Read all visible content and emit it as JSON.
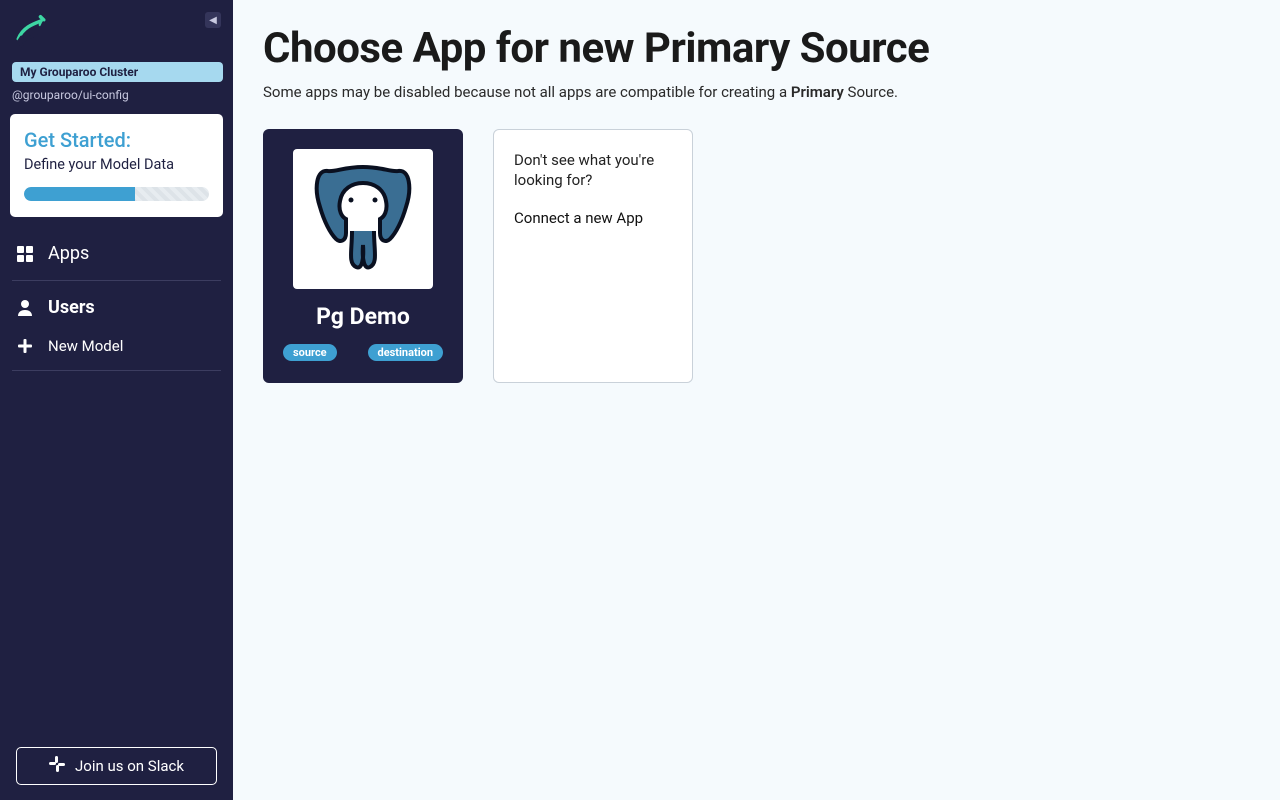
{
  "sidebar": {
    "cluster_label": "My Grouparoo Cluster",
    "package_line": "@grouparoo/ui-config",
    "get_started": {
      "title": "Get Started:",
      "subtitle": "Define your Model Data",
      "progress_percent": 60
    },
    "nav": {
      "apps": "Apps",
      "users": "Users",
      "new_model": "New Model"
    },
    "slack_button": "Join us on Slack"
  },
  "main": {
    "title": "Choose App for new Primary Source",
    "subtitle_pre": "Some apps may be disabled because not all apps are compatible for creating a ",
    "subtitle_emph": "Primary",
    "subtitle_post": " Source.",
    "app_card": {
      "name": "Pg Demo",
      "pill_source": "source",
      "pill_destination": "destination"
    },
    "empty_card": {
      "line1": "Don't see what you're looking for?",
      "line2": "Connect a new App"
    }
  }
}
